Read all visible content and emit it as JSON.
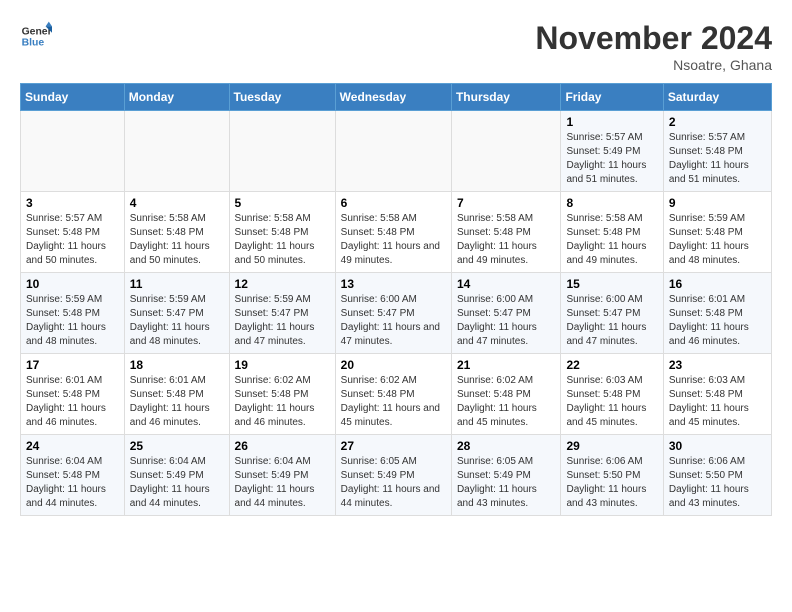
{
  "logo": {
    "line1": "General",
    "line2": "Blue"
  },
  "title": "November 2024",
  "subtitle": "Nsoatre, Ghana",
  "days_header": [
    "Sunday",
    "Monday",
    "Tuesday",
    "Wednesday",
    "Thursday",
    "Friday",
    "Saturday"
  ],
  "weeks": [
    [
      {
        "day": "",
        "sunrise": "",
        "sunset": "",
        "daylight": ""
      },
      {
        "day": "",
        "sunrise": "",
        "sunset": "",
        "daylight": ""
      },
      {
        "day": "",
        "sunrise": "",
        "sunset": "",
        "daylight": ""
      },
      {
        "day": "",
        "sunrise": "",
        "sunset": "",
        "daylight": ""
      },
      {
        "day": "",
        "sunrise": "",
        "sunset": "",
        "daylight": ""
      },
      {
        "day": "1",
        "sunrise": "Sunrise: 5:57 AM",
        "sunset": "Sunset: 5:49 PM",
        "daylight": "Daylight: 11 hours and 51 minutes."
      },
      {
        "day": "2",
        "sunrise": "Sunrise: 5:57 AM",
        "sunset": "Sunset: 5:48 PM",
        "daylight": "Daylight: 11 hours and 51 minutes."
      }
    ],
    [
      {
        "day": "3",
        "sunrise": "Sunrise: 5:57 AM",
        "sunset": "Sunset: 5:48 PM",
        "daylight": "Daylight: 11 hours and 50 minutes."
      },
      {
        "day": "4",
        "sunrise": "Sunrise: 5:58 AM",
        "sunset": "Sunset: 5:48 PM",
        "daylight": "Daylight: 11 hours and 50 minutes."
      },
      {
        "day": "5",
        "sunrise": "Sunrise: 5:58 AM",
        "sunset": "Sunset: 5:48 PM",
        "daylight": "Daylight: 11 hours and 50 minutes."
      },
      {
        "day": "6",
        "sunrise": "Sunrise: 5:58 AM",
        "sunset": "Sunset: 5:48 PM",
        "daylight": "Daylight: 11 hours and 49 minutes."
      },
      {
        "day": "7",
        "sunrise": "Sunrise: 5:58 AM",
        "sunset": "Sunset: 5:48 PM",
        "daylight": "Daylight: 11 hours and 49 minutes."
      },
      {
        "day": "8",
        "sunrise": "Sunrise: 5:58 AM",
        "sunset": "Sunset: 5:48 PM",
        "daylight": "Daylight: 11 hours and 49 minutes."
      },
      {
        "day": "9",
        "sunrise": "Sunrise: 5:59 AM",
        "sunset": "Sunset: 5:48 PM",
        "daylight": "Daylight: 11 hours and 48 minutes."
      }
    ],
    [
      {
        "day": "10",
        "sunrise": "Sunrise: 5:59 AM",
        "sunset": "Sunset: 5:48 PM",
        "daylight": "Daylight: 11 hours and 48 minutes."
      },
      {
        "day": "11",
        "sunrise": "Sunrise: 5:59 AM",
        "sunset": "Sunset: 5:47 PM",
        "daylight": "Daylight: 11 hours and 48 minutes."
      },
      {
        "day": "12",
        "sunrise": "Sunrise: 5:59 AM",
        "sunset": "Sunset: 5:47 PM",
        "daylight": "Daylight: 11 hours and 47 minutes."
      },
      {
        "day": "13",
        "sunrise": "Sunrise: 6:00 AM",
        "sunset": "Sunset: 5:47 PM",
        "daylight": "Daylight: 11 hours and 47 minutes."
      },
      {
        "day": "14",
        "sunrise": "Sunrise: 6:00 AM",
        "sunset": "Sunset: 5:47 PM",
        "daylight": "Daylight: 11 hours and 47 minutes."
      },
      {
        "day": "15",
        "sunrise": "Sunrise: 6:00 AM",
        "sunset": "Sunset: 5:47 PM",
        "daylight": "Daylight: 11 hours and 47 minutes."
      },
      {
        "day": "16",
        "sunrise": "Sunrise: 6:01 AM",
        "sunset": "Sunset: 5:48 PM",
        "daylight": "Daylight: 11 hours and 46 minutes."
      }
    ],
    [
      {
        "day": "17",
        "sunrise": "Sunrise: 6:01 AM",
        "sunset": "Sunset: 5:48 PM",
        "daylight": "Daylight: 11 hours and 46 minutes."
      },
      {
        "day": "18",
        "sunrise": "Sunrise: 6:01 AM",
        "sunset": "Sunset: 5:48 PM",
        "daylight": "Daylight: 11 hours and 46 minutes."
      },
      {
        "day": "19",
        "sunrise": "Sunrise: 6:02 AM",
        "sunset": "Sunset: 5:48 PM",
        "daylight": "Daylight: 11 hours and 46 minutes."
      },
      {
        "day": "20",
        "sunrise": "Sunrise: 6:02 AM",
        "sunset": "Sunset: 5:48 PM",
        "daylight": "Daylight: 11 hours and 45 minutes."
      },
      {
        "day": "21",
        "sunrise": "Sunrise: 6:02 AM",
        "sunset": "Sunset: 5:48 PM",
        "daylight": "Daylight: 11 hours and 45 minutes."
      },
      {
        "day": "22",
        "sunrise": "Sunrise: 6:03 AM",
        "sunset": "Sunset: 5:48 PM",
        "daylight": "Daylight: 11 hours and 45 minutes."
      },
      {
        "day": "23",
        "sunrise": "Sunrise: 6:03 AM",
        "sunset": "Sunset: 5:48 PM",
        "daylight": "Daylight: 11 hours and 45 minutes."
      }
    ],
    [
      {
        "day": "24",
        "sunrise": "Sunrise: 6:04 AM",
        "sunset": "Sunset: 5:48 PM",
        "daylight": "Daylight: 11 hours and 44 minutes."
      },
      {
        "day": "25",
        "sunrise": "Sunrise: 6:04 AM",
        "sunset": "Sunset: 5:49 PM",
        "daylight": "Daylight: 11 hours and 44 minutes."
      },
      {
        "day": "26",
        "sunrise": "Sunrise: 6:04 AM",
        "sunset": "Sunset: 5:49 PM",
        "daylight": "Daylight: 11 hours and 44 minutes."
      },
      {
        "day": "27",
        "sunrise": "Sunrise: 6:05 AM",
        "sunset": "Sunset: 5:49 PM",
        "daylight": "Daylight: 11 hours and 44 minutes."
      },
      {
        "day": "28",
        "sunrise": "Sunrise: 6:05 AM",
        "sunset": "Sunset: 5:49 PM",
        "daylight": "Daylight: 11 hours and 43 minutes."
      },
      {
        "day": "29",
        "sunrise": "Sunrise: 6:06 AM",
        "sunset": "Sunset: 5:50 PM",
        "daylight": "Daylight: 11 hours and 43 minutes."
      },
      {
        "day": "30",
        "sunrise": "Sunrise: 6:06 AM",
        "sunset": "Sunset: 5:50 PM",
        "daylight": "Daylight: 11 hours and 43 minutes."
      }
    ]
  ]
}
